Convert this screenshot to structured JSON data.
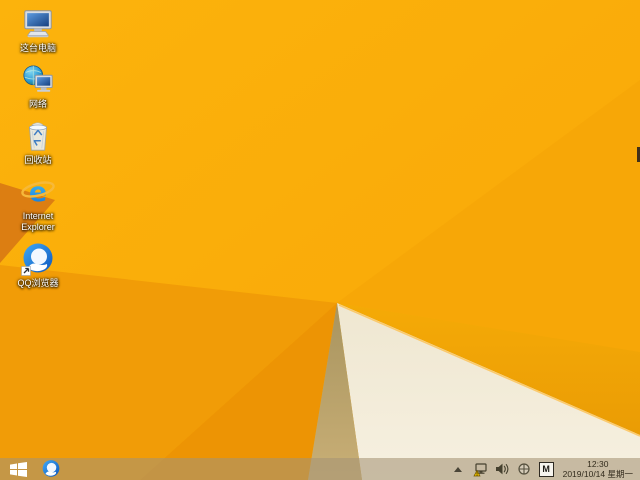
{
  "desktop": {
    "icons": [
      {
        "name": "this-pc",
        "label": "这台电脑"
      },
      {
        "name": "network",
        "label": "网络"
      },
      {
        "name": "recycle-bin",
        "label": "回收站"
      },
      {
        "name": "internet-explorer",
        "label": "Internet Explorer"
      },
      {
        "name": "qq-browser",
        "label": "QQ浏览器"
      }
    ]
  },
  "taskbar": {
    "start_button": {
      "icon": "windows-logo"
    },
    "pinned": [
      {
        "name": "qq-browser"
      }
    ],
    "tray": {
      "icons": [
        "hidden-icons-arrow",
        "network-status-warning",
        "volume",
        "safely-remove-hardware",
        "ime-indicator"
      ],
      "ime_label": "M",
      "clock": {
        "time": "12:30",
        "date": "2019/10/14 星期一"
      }
    }
  },
  "colors": {
    "wallpaper_orange": "#F9AA08",
    "wallpaper_amber_band": "#EFA105",
    "wallpaper_cream": "#F3ECDA",
    "wallpaper_tan": "#B7A169",
    "wallpaper_dark_fold": "#DC7E12",
    "taskbar_tint": "#C89B55",
    "icon_label_text": "#FFFFFF",
    "tray_glyph": "#3D3A30"
  }
}
